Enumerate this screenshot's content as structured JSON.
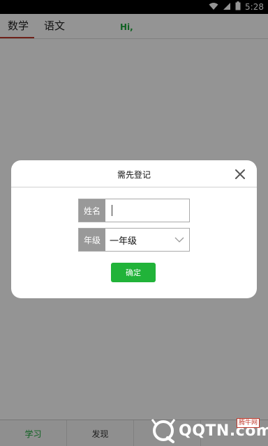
{
  "status_bar": {
    "time": "5:28",
    "icons": [
      "wifi-icon",
      "signal-icon",
      "battery-icon"
    ]
  },
  "tabs": {
    "math": "数学",
    "chinese": "语文",
    "greeting": "Hi,"
  },
  "bottom_nav": {
    "items": [
      "学习",
      "发现",
      "",
      ""
    ]
  },
  "dialog": {
    "title": "需先登记",
    "name_label": "姓名",
    "name_value": "",
    "grade_label": "年级",
    "grade_value": "一年级",
    "confirm_label": "确定"
  },
  "watermark": {
    "text": "QQTN.com",
    "badge": "腾牛网"
  },
  "colors": {
    "accent_green": "#21b339",
    "tab_underline": "#c0392b",
    "label_bg": "#999999"
  }
}
